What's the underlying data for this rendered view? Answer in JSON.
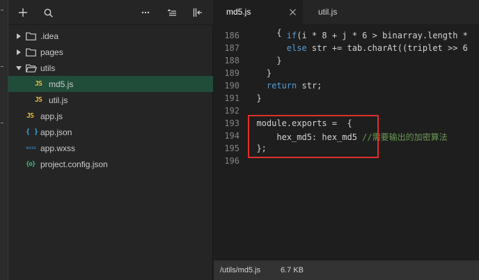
{
  "explorer": {
    "tree": [
      {
        "label": ".idea",
        "type": "folder",
        "expanded": false,
        "depth": 0
      },
      {
        "label": "pages",
        "type": "folder",
        "expanded": false,
        "depth": 0
      },
      {
        "label": "utils",
        "type": "folder",
        "expanded": true,
        "depth": 0
      },
      {
        "label": "md5.js",
        "type": "js",
        "depth": 1,
        "selected": true
      },
      {
        "label": "util.js",
        "type": "js",
        "depth": 1
      },
      {
        "label": "app.js",
        "type": "js",
        "depth": 0
      },
      {
        "label": "app.json",
        "type": "json",
        "depth": 0
      },
      {
        "label": "app.wxss",
        "type": "wxss",
        "depth": 0
      },
      {
        "label": "project.config.json",
        "type": "config",
        "depth": 0
      }
    ],
    "icons": {
      "js": "JS",
      "json": "{ }",
      "wxss": "wxss",
      "config": "{o}"
    }
  },
  "editor": {
    "tabs": [
      {
        "label": "md5.js",
        "active": true
      },
      {
        "label": "util.js",
        "active": false
      }
    ],
    "lines": [
      {
        "n": "186",
        "code": "        if(i * 8 + j * 6 > binarray.length * "
      },
      {
        "n": "187",
        "code": "        else str += tab.charAt((triplet >> 6"
      },
      {
        "n": "188",
        "code": "      }"
      },
      {
        "n": "189",
        "code": "    }"
      },
      {
        "n": "190",
        "code": "    return str;"
      },
      {
        "n": "191",
        "code": "  }"
      },
      {
        "n": "192",
        "code": ""
      },
      {
        "n": "193",
        "code": "  module.exports =  {"
      },
      {
        "n": "194",
        "code": "      hex_md5: hex_md5 //需要输出的加密算法"
      },
      {
        "n": "195",
        "code": "  };"
      },
      {
        "n": "196",
        "code": ""
      }
    ]
  },
  "statusbar": {
    "path": "/utils/md5.js",
    "size": "6.7 KB"
  },
  "colors": {
    "selection": "#1f4d3a",
    "highlight_box": "#e0302c",
    "keyword": "#569cd6",
    "comment": "#6a9955"
  }
}
